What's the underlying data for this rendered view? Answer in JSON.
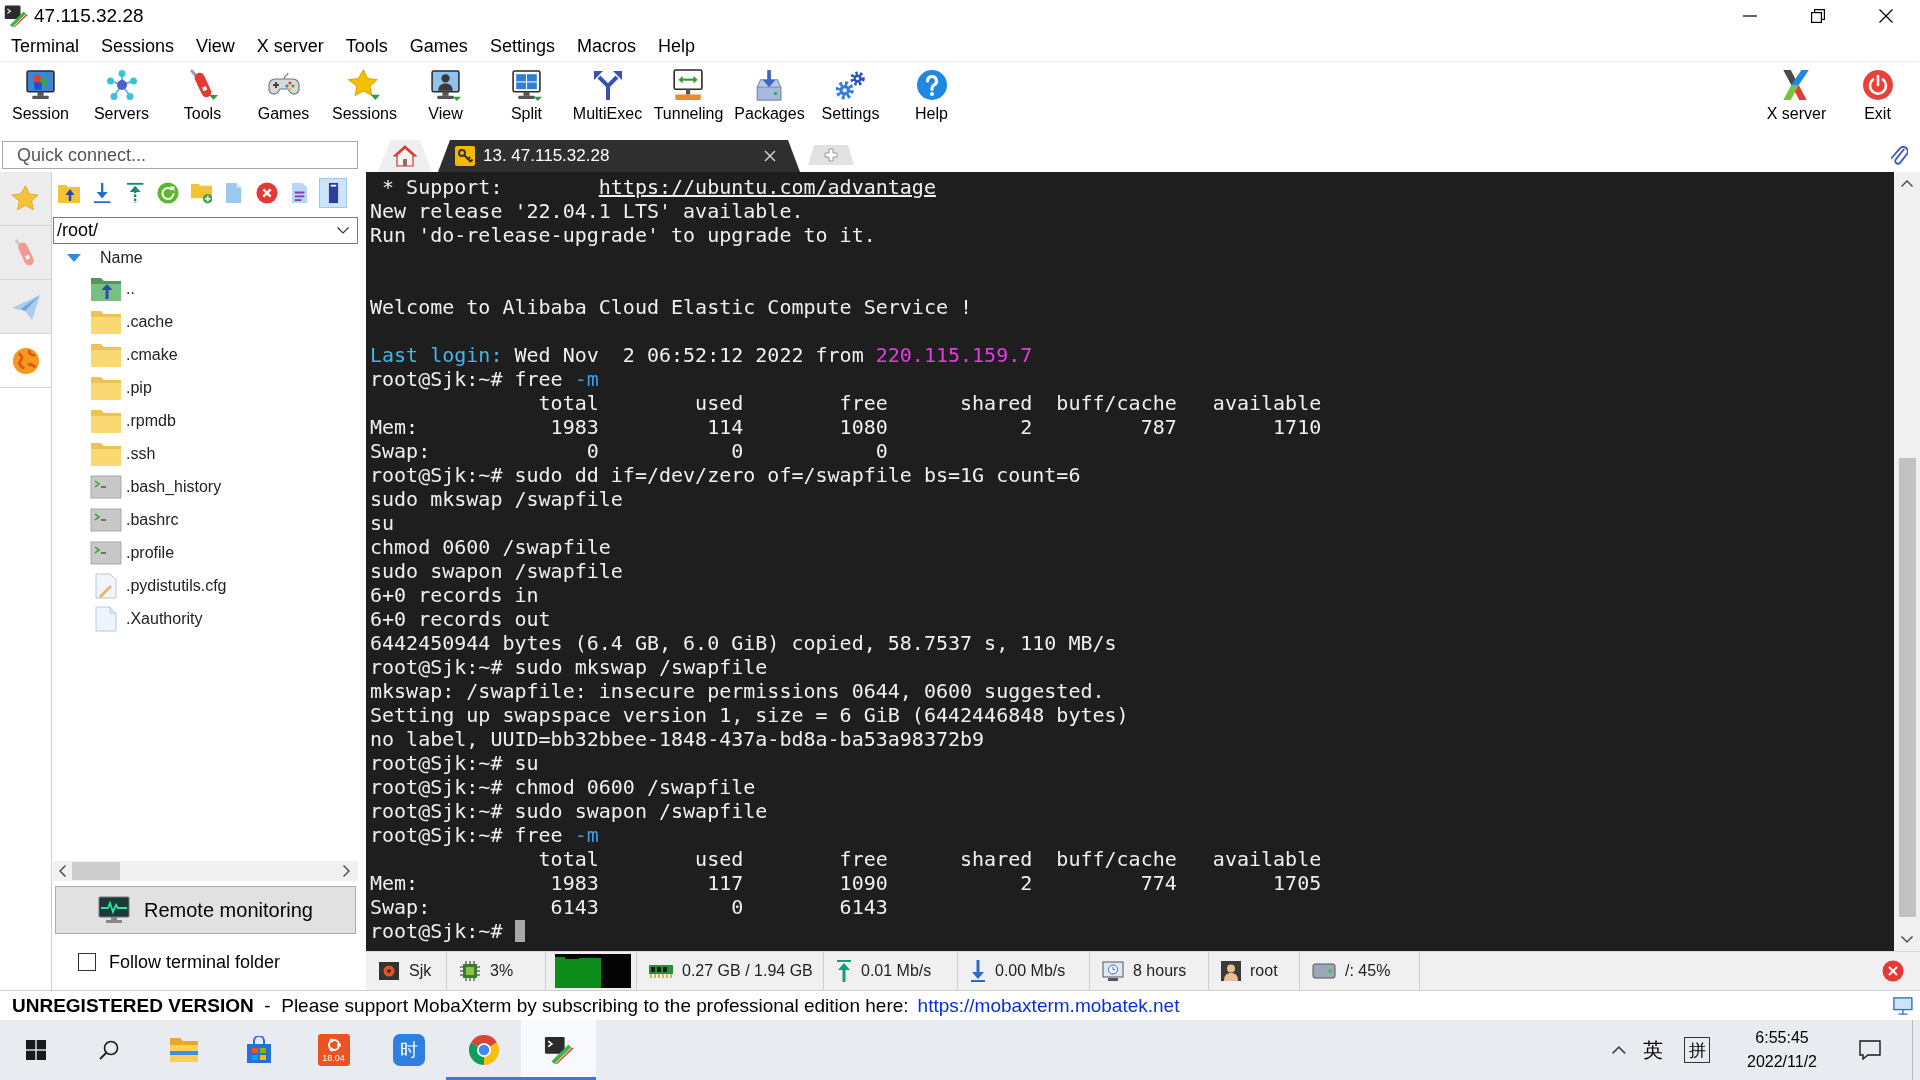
{
  "window": {
    "title": "47.115.32.28"
  },
  "menu": [
    "Terminal",
    "Sessions",
    "View",
    "X server",
    "Tools",
    "Games",
    "Settings",
    "Macros",
    "Help"
  ],
  "toolbar": {
    "buttons": [
      "Session",
      "Servers",
      "Tools",
      "Games",
      "Sessions",
      "View",
      "Split",
      "MultiExec",
      "Tunneling",
      "Packages",
      "Settings",
      "Help"
    ],
    "right_buttons": [
      "X server",
      "Exit"
    ]
  },
  "quick_connect": {
    "placeholder": "Quick connect..."
  },
  "session_tabs": [
    {
      "kind": "home",
      "selected": false
    },
    {
      "kind": "session",
      "label": "13. 47.115.32.28",
      "selected": true
    }
  ],
  "sidebar": {
    "tabs": [
      {
        "selected": false
      },
      {
        "selected": false
      },
      {
        "selected": false
      },
      {
        "selected": true
      }
    ],
    "sftp_toolbar": [
      {
        "pressed": false
      },
      {
        "pressed": false
      },
      {
        "pressed": false
      },
      {
        "pressed": false
      },
      {
        "pressed": false
      },
      {
        "pressed": false
      },
      {
        "pressed": false
      },
      {
        "pressed": false
      },
      {
        "pressed": true
      }
    ],
    "path": "/root/",
    "column": "Name",
    "files": [
      {
        "kind": "parent",
        "name": "..",
        "selected": false
      },
      {
        "kind": "folder",
        "name": ".cache",
        "selected": false
      },
      {
        "kind": "folder",
        "name": ".cmake",
        "selected": false
      },
      {
        "kind": "folder",
        "name": ".pip",
        "selected": false
      },
      {
        "kind": "folder",
        "name": ".rpmdb",
        "selected": false
      },
      {
        "kind": "folder",
        "name": ".ssh",
        "selected": false
      },
      {
        "kind": "shell",
        "name": ".bash_history",
        "selected": false
      },
      {
        "kind": "shell",
        "name": ".bashrc",
        "selected": false
      },
      {
        "kind": "shell",
        "name": ".profile",
        "selected": false
      },
      {
        "kind": "edit",
        "name": ".pydistutils.cfg",
        "selected": false
      },
      {
        "kind": "file",
        "name": ".Xauthority",
        "selected": false
      }
    ],
    "remote_monitoring": "Remote monitoring",
    "follow_folder": {
      "label": "Follow terminal folder",
      "checked": false
    }
  },
  "terminal": {
    "lines": [
      {
        "kind": "spans",
        "spans": [
          {
            "kind": "plain",
            "text": " * Support:        "
          },
          {
            "kind": "link",
            "text": "https://ubuntu.com/advantage"
          }
        ]
      },
      {
        "kind": "text",
        "text": "New release '22.04.1 LTS' available."
      },
      {
        "kind": "text",
        "text": "Run 'do-release-upgrade' to upgrade to it."
      },
      {
        "kind": "blank"
      },
      {
        "kind": "blank"
      },
      {
        "kind": "text",
        "text": "Welcome to Alibaba Cloud Elastic Compute Service !"
      },
      {
        "kind": "blank"
      },
      {
        "kind": "spans",
        "spans": [
          {
            "kind": "colored",
            "text": "Last login:",
            "color": "#3fb8e8"
          },
          {
            "kind": "plain",
            "text": " Wed Nov  2 06:52:12 2022 from "
          },
          {
            "kind": "colored",
            "text": "220.115.159.7",
            "color": "#e23de2"
          }
        ]
      },
      {
        "kind": "spans",
        "spans": [
          {
            "kind": "plain",
            "text": "root@Sjk:~# free "
          },
          {
            "kind": "colored",
            "text": "-m",
            "color": "#3c9be8"
          }
        ]
      },
      {
        "kind": "text",
        "text": "              total        used        free      shared  buff/cache   available"
      },
      {
        "kind": "text",
        "text": "Mem:           1983         114        1080           2         787        1710"
      },
      {
        "kind": "text",
        "text": "Swap:             0           0           0"
      },
      {
        "kind": "text",
        "text": "root@Sjk:~# sudo dd if=/dev/zero of=/swapfile bs=1G count=6"
      },
      {
        "kind": "text",
        "text": "sudo mkswap /swapfile"
      },
      {
        "kind": "text",
        "text": "su"
      },
      {
        "kind": "text",
        "text": "chmod 0600 /swapfile"
      },
      {
        "kind": "text",
        "text": "sudo swapon /swapfile"
      },
      {
        "kind": "text",
        "text": "6+0 records in"
      },
      {
        "kind": "text",
        "text": "6+0 records out"
      },
      {
        "kind": "text",
        "text": "6442450944 bytes (6.4 GB, 6.0 GiB) copied, 58.7537 s, 110 MB/s"
      },
      {
        "kind": "text",
        "text": "root@Sjk:~# sudo mkswap /swapfile"
      },
      {
        "kind": "text",
        "text": "mkswap: /swapfile: insecure permissions 0644, 0600 suggested."
      },
      {
        "kind": "text",
        "text": "Setting up swapspace version 1, size = 6 GiB (6442446848 bytes)"
      },
      {
        "kind": "text",
        "text": "no label, UUID=bb32bbee-1848-437a-bd8a-ba53a98372b9"
      },
      {
        "kind": "text",
        "text": "root@Sjk:~# su"
      },
      {
        "kind": "text",
        "text": "root@Sjk:~# chmod 0600 /swapfile"
      },
      {
        "kind": "text",
        "text": "root@Sjk:~# sudo swapon /swapfile"
      },
      {
        "kind": "spans",
        "spans": [
          {
            "kind": "plain",
            "text": "root@Sjk:~# free "
          },
          {
            "kind": "colored",
            "text": "-m",
            "color": "#3c9be8"
          }
        ]
      },
      {
        "kind": "text",
        "text": "              total        used        free      shared  buff/cache   available"
      },
      {
        "kind": "text",
        "text": "Mem:           1983         117        1090           2         774        1705"
      },
      {
        "kind": "text",
        "text": "Swap:          6143           0        6143"
      },
      {
        "kind": "spans",
        "spans": [
          {
            "kind": "plain",
            "text": "root@Sjk:~# "
          },
          {
            "kind": "cursor"
          }
        ]
      }
    ]
  },
  "status_bar": {
    "items": [
      {
        "kind": "session",
        "text": "Sjk"
      },
      {
        "kind": "cpu",
        "text": "3%"
      },
      {
        "kind": "graph"
      },
      {
        "kind": "memory",
        "text": "0.27 GB / 1.94 GB"
      },
      {
        "kind": "upload",
        "text": "0.01 Mb/s"
      },
      {
        "kind": "download",
        "text": "0.00 Mb/s"
      },
      {
        "kind": "uptime",
        "text": "8 hours"
      },
      {
        "kind": "user",
        "text": "root"
      },
      {
        "kind": "disk",
        "text": "/: 45%"
      }
    ]
  },
  "notice": {
    "text": "**UNREGISTERED VERSION**  -  Please support MobaXterm by subscribing to the professional edition here:",
    "link": "https://mobaxterm.mobatek.net"
  },
  "taskbar": {
    "apps": [
      {
        "kind": "explorer",
        "running": false,
        "active": false
      },
      {
        "kind": "store",
        "running": false,
        "active": false
      },
      {
        "kind": "ubuntu",
        "badge": "18.04",
        "running": false,
        "active": false
      },
      {
        "kind": "tile",
        "glyph": "时",
        "running": false,
        "active": false
      },
      {
        "kind": "browser",
        "running": true,
        "active": false
      },
      {
        "kind": "terminal",
        "running": true,
        "active": true
      }
    ],
    "tray": {
      "input_mode": "英",
      "ime": "拼"
    },
    "clock": {
      "time": "6:55:45",
      "date": "2022/11/2"
    }
  }
}
